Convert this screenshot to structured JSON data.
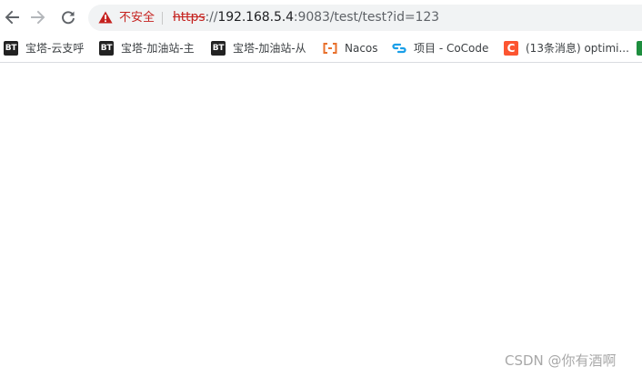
{
  "address_bar": {
    "security_label": "不安全",
    "url_scheme": "https",
    "url_separator": "://",
    "url_host": "192.168.5.4",
    "url_rest": ":9083/test/test?id=123"
  },
  "bookmarks": [
    {
      "icon_text": "BT",
      "label": "宝塔-云支呼"
    },
    {
      "icon_text": "BT",
      "label": "宝塔-加油站-主"
    },
    {
      "icon_text": "BT",
      "label": "宝塔-加油站-从"
    },
    {
      "icon": "nacos-icon",
      "label": "Nacos"
    },
    {
      "icon": "cocode-icon",
      "label": "项目 - CoCode"
    },
    {
      "icon_text": "C",
      "label": "(13条消息) optimi..."
    },
    {
      "icon": "green-bookmark-icon",
      "label": ""
    }
  ],
  "watermark": "CSDN @你有酒啊",
  "colors": {
    "insecure_red": "#c5221f",
    "omnibox_bg": "#f1f3f4",
    "csdn_orange": "#fc5531",
    "nacos_orange": "#e8712d",
    "cocode_blue": "#1a9fe8"
  }
}
